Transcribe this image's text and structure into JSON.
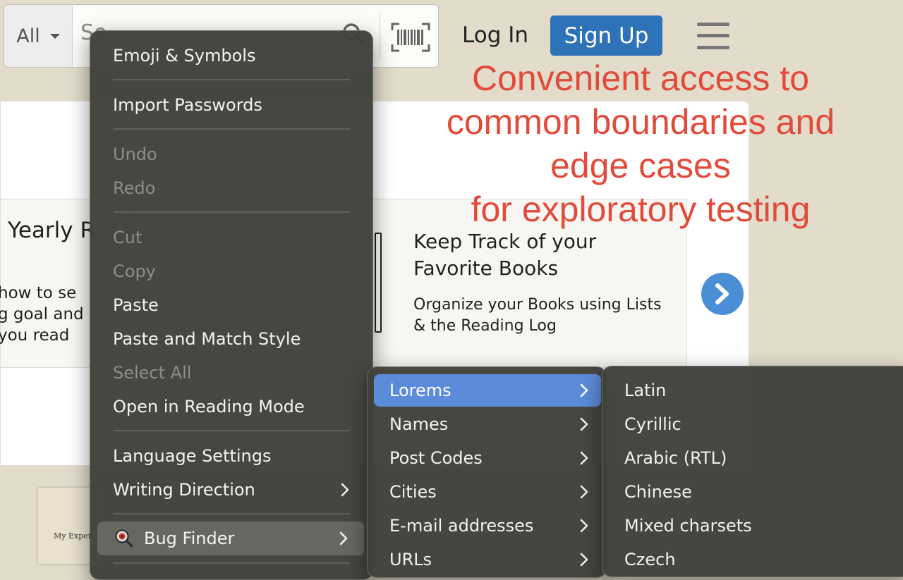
{
  "header": {
    "search_scope": "All",
    "search_placeholder": "Se",
    "login_label": "Log In",
    "signup_label": "Sign Up"
  },
  "annotation": {
    "lines": [
      "Convenient access to",
      "common boundaries and",
      "edge cases",
      "for exploratory testing"
    ],
    "color": "#e24b3a"
  },
  "cards": {
    "left_title": "Yearly R",
    "left_desc": "how to se\ng goal and\nyou read",
    "right_title": "Keep Track of your Favorite Books",
    "right_desc": "Organize your Books using Lists & the Reading Log"
  },
  "book_thumb_text": "My Exper",
  "context_menu": {
    "items": [
      {
        "label": "Emoji & Symbols",
        "disabled": false
      },
      {
        "label": "Import Passwords",
        "disabled": false
      },
      {
        "label": "Undo",
        "disabled": true
      },
      {
        "label": "Redo",
        "disabled": true
      },
      {
        "label": "Cut",
        "disabled": true
      },
      {
        "label": "Copy",
        "disabled": true
      },
      {
        "label": "Paste",
        "disabled": false
      },
      {
        "label": "Paste and Match Style",
        "disabled": false
      },
      {
        "label": "Select All",
        "disabled": true
      },
      {
        "label": "Open in Reading Mode",
        "disabled": false
      },
      {
        "label": "Language Settings",
        "disabled": false
      },
      {
        "label": "Writing Direction",
        "disabled": false,
        "submenu": true
      },
      {
        "label": "Bug Finder",
        "disabled": false,
        "submenu": true,
        "highlighted": true,
        "icon": "bug-finder-icon"
      }
    ]
  },
  "bug_finder_menu": {
    "items": [
      {
        "label": "Lorems",
        "active": true
      },
      {
        "label": "Names"
      },
      {
        "label": "Post Codes"
      },
      {
        "label": "Cities"
      },
      {
        "label": "E-mail addresses"
      },
      {
        "label": "URLs"
      }
    ]
  },
  "lorems_menu": {
    "items": [
      {
        "label": "Latin"
      },
      {
        "label": "Cyrillic"
      },
      {
        "label": "Arabic (RTL)"
      },
      {
        "label": "Chinese"
      },
      {
        "label": "Mixed charsets"
      },
      {
        "label": "Czech"
      }
    ]
  },
  "colors": {
    "page_bg": "#e3dccb",
    "signup_bg": "#2e72b7",
    "menu_bg": "#403f3a",
    "menu_highlight": "#5b8bd9"
  }
}
